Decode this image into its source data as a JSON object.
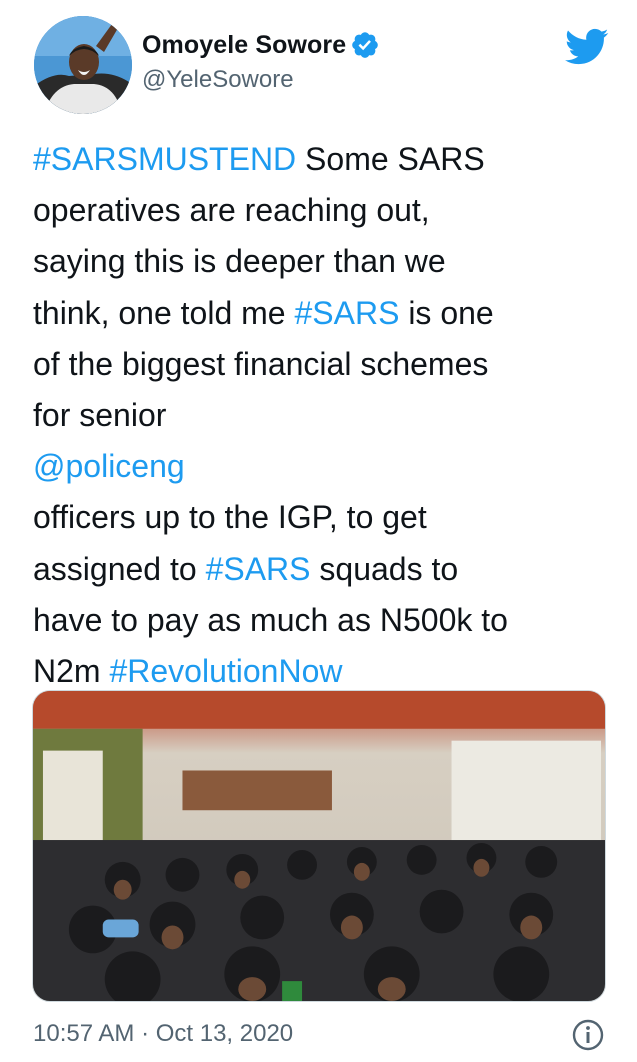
{
  "author": {
    "display_name": "Omoyele Sowore",
    "handle": "@YeleSowore",
    "verified": true
  },
  "icons": {
    "verified": "verified-badge-icon",
    "brand": "twitter-bird-icon",
    "info": "info-icon"
  },
  "colors": {
    "link": "#1d9bf0",
    "text": "#0f1419",
    "muted": "#536471",
    "verified": "#1d9bf0"
  },
  "tweet": {
    "lines": [
      [
        {
          "text": "#SARSMUSTEND",
          "link": true
        },
        {
          "text": " Some SARS",
          "link": false
        }
      ],
      [
        {
          "text": "operatives are reaching out,",
          "link": false
        }
      ],
      [
        {
          "text": "saying this is deeper than we",
          "link": false
        }
      ],
      [
        {
          "text": "think, one told me ",
          "link": false
        },
        {
          "text": "#SARS",
          "link": true
        },
        {
          "text": " is one",
          "link": false
        }
      ],
      [
        {
          "text": "of the biggest financial schemes",
          "link": false
        }
      ],
      [
        {
          "text": "for senior",
          "link": false
        }
      ],
      [
        {
          "text": "@policeng",
          "link": true
        }
      ],
      [
        {
          "text": " officers up to the IGP, to get",
          "link": false
        }
      ],
      [
        {
          "text": "assigned to ",
          "link": false
        },
        {
          "text": "#SARS",
          "link": true
        },
        {
          "text": " squads to",
          "link": false
        }
      ],
      [
        {
          "text": "have to pay as much as N500k to",
          "link": false
        }
      ],
      [
        {
          "text": "N2m ",
          "link": false
        },
        {
          "text": "#RevolutionNow",
          "link": true
        }
      ]
    ],
    "timestamp": "10:57 AM · Oct 13, 2020"
  }
}
